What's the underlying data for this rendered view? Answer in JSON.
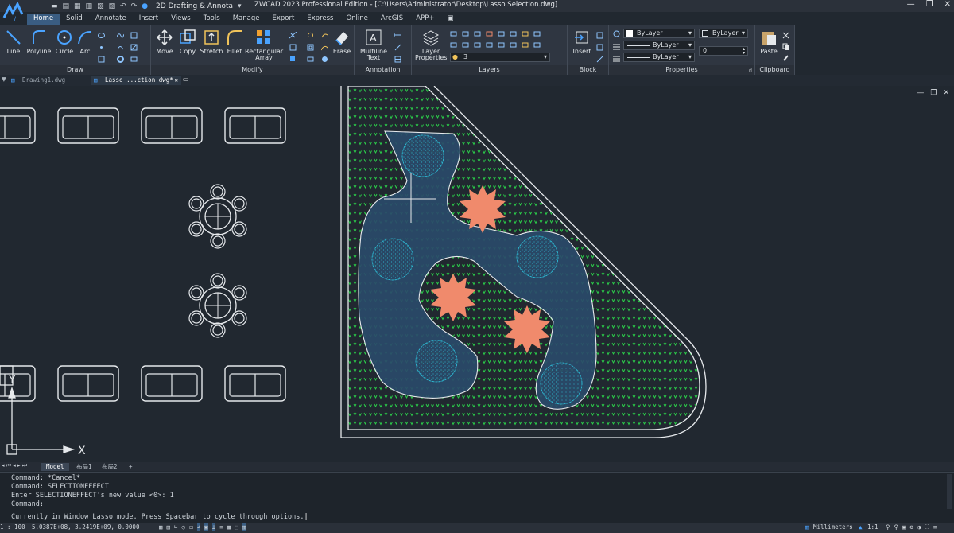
{
  "app": {
    "title": "ZWCAD 2023 Professional Edition - [C:\\Users\\Administrator\\Desktop\\Lasso Selection.dwg]",
    "workspace": "2D Drafting & Annota"
  },
  "menu": [
    "Home",
    "Solid",
    "Annotate",
    "Insert",
    "Views",
    "Tools",
    "Manage",
    "Export",
    "Express",
    "Online",
    "ArcGIS",
    "APP+"
  ],
  "ribbon": {
    "draw": {
      "label": "Draw",
      "line": "Line",
      "polyline": "Polyline",
      "circle": "Circle",
      "arc": "Arc"
    },
    "modify": {
      "label": "Modify",
      "move": "Move",
      "copy": "Copy",
      "stretch": "Stretch",
      "fillet": "Fillet",
      "array": "Rectangular Array",
      "erase": "Erase"
    },
    "annotation": {
      "label": "Annotation",
      "mtext": "Multiline Text"
    },
    "layers": {
      "label": "Layers",
      "layer_properties": "Layer Properties",
      "current_layer": "3"
    },
    "block": {
      "label": "Block",
      "insert": "Insert"
    },
    "properties": {
      "label": "Properties",
      "color": "ByLayer",
      "linetype": "ByLayer",
      "lineweight": "ByLayer",
      "plotstyle": "ByLayer",
      "transparency": "0"
    },
    "clipboard": {
      "label": "Clipboard",
      "paste": "Paste"
    }
  },
  "file_tabs": [
    {
      "label": "Drawing1.dwg"
    },
    {
      "label": "Lasso ...ction.dwg*"
    }
  ],
  "layout_tabs": [
    "Model",
    "布局1",
    "布局2",
    "+"
  ],
  "command_history": [
    "Command: *Cancel*",
    "Command: SELECTIONEFFECT",
    "Enter SELECTIONEFFECT's new value  <0>: 1",
    "Command:"
  ],
  "prompt": "Currently in Window Lasso mode. Press Spacebar to cycle through options.",
  "status": {
    "coords": "5.0387E+08, 3.2419E+09, 0.0000",
    "scale_left": "1 : 100",
    "units": "Millimeters",
    "anno_scale": "1:1"
  },
  "colors": {
    "accent": "#3a5d82",
    "lasso_fill": "#2a4a6a",
    "shrub": "#f08a6c",
    "tree": "#2ec7e0",
    "grass": "#2bd24a"
  }
}
